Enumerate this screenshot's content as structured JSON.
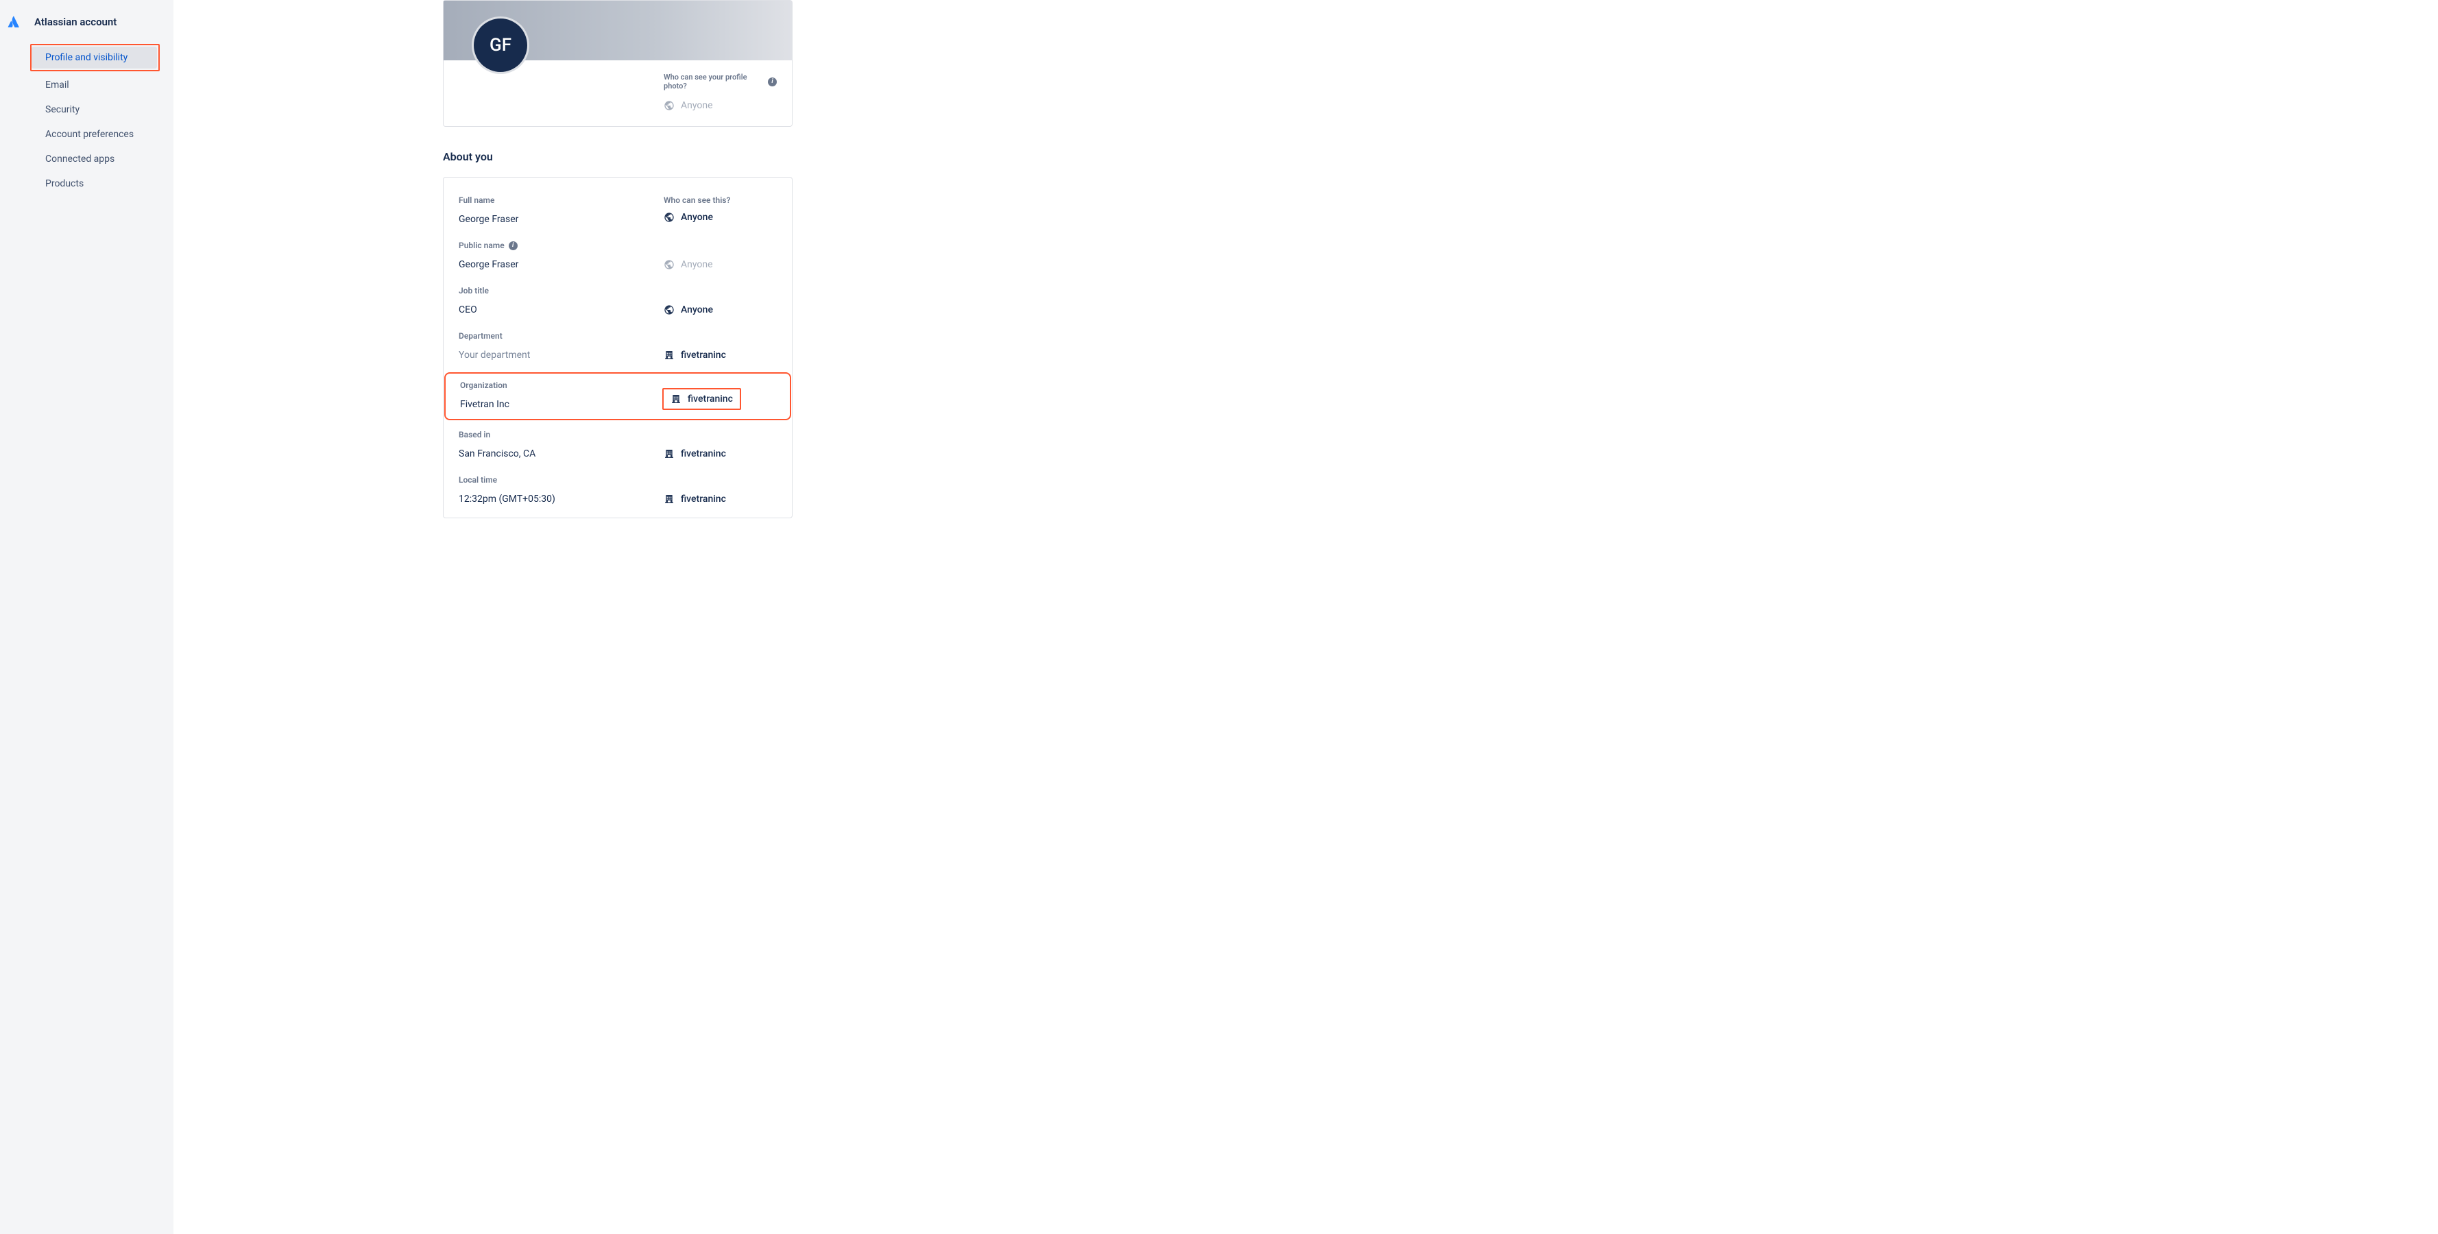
{
  "sidebar": {
    "title": "Atlassian account",
    "items": [
      {
        "label": "Profile and visibility",
        "active": true,
        "highlighted": true
      },
      {
        "label": "Email"
      },
      {
        "label": "Security"
      },
      {
        "label": "Account preferences"
      },
      {
        "label": "Connected apps"
      },
      {
        "label": "Products"
      }
    ]
  },
  "profile": {
    "avatar_initials": "GF",
    "photo_visibility_label": "Who can see your profile photo?",
    "photo_visibility_value": "Anyone"
  },
  "about": {
    "title": "About you",
    "who_can_see_label": "Who can see this?",
    "fields": {
      "full_name": {
        "label": "Full name",
        "value": "George Fraser",
        "visibility": "Anyone",
        "vis_type": "globe",
        "enabled": true
      },
      "public_name": {
        "label": "Public name",
        "value": "George Fraser",
        "visibility": "Anyone",
        "vis_type": "globe",
        "enabled": false
      },
      "job_title": {
        "label": "Job title",
        "value": "CEO",
        "visibility": "Anyone",
        "vis_type": "globe",
        "enabled": true
      },
      "department": {
        "label": "Department",
        "placeholder": "Your department",
        "visibility": "fivetraninc",
        "vis_type": "building",
        "enabled": true
      },
      "organization": {
        "label": "Organization",
        "value": "Fivetran Inc",
        "visibility": "fivetraninc",
        "vis_type": "building",
        "enabled": true
      },
      "based_in": {
        "label": "Based in",
        "value": "San Francisco, CA",
        "visibility": "fivetraninc",
        "vis_type": "building",
        "enabled": true
      },
      "local_time": {
        "label": "Local time",
        "value": "12:32pm (GMT+05:30)",
        "visibility": "fivetraninc",
        "vis_type": "building",
        "enabled": true
      }
    }
  }
}
